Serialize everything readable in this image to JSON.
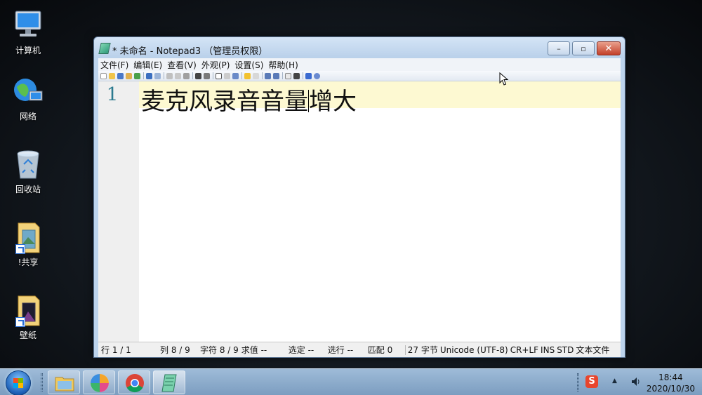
{
  "desktop": {
    "icons": [
      {
        "label": "计算机",
        "icon": "computer-icon"
      },
      {
        "label": "网络",
        "icon": "network-icon"
      },
      {
        "label": "回收站",
        "icon": "recycle-bin-icon"
      },
      {
        "label": "!共享",
        "icon": "folder-shortcut-icon"
      },
      {
        "label": "壁纸",
        "icon": "folder-shortcut-icon"
      }
    ]
  },
  "window": {
    "title": "* 未命名 - Notepad3 （管理员权限）",
    "controls": {
      "minimize": "–",
      "maximize": "▫",
      "close": "✕"
    },
    "menu": [
      "文件(F)",
      "编辑(E)",
      "查看(V)",
      "外观(P)",
      "设置(S)",
      "帮助(H)"
    ],
    "editor": {
      "line_number": "1",
      "text_before_caret": "麦克风录音音量",
      "text_after_caret": "增大"
    },
    "status": {
      "line": "行 1 / 1",
      "column": "列 8 / 9",
      "chars": "字符 8 / 9",
      "sum": "求值 --",
      "selection": "选定 --",
      "sel_lines": "选行 --",
      "match": "匹配 0",
      "size": "27 字节",
      "encoding": "Unicode (UTF-8)",
      "eol": "CR+LF",
      "ins": "INS",
      "std": "STD",
      "type": "文本文件"
    }
  },
  "taskbar": {
    "apps": [
      "file-explorer-icon",
      "pinwheel-app-icon",
      "chrome-icon",
      "notepad3-icon"
    ],
    "tray": {
      "ime": "S",
      "time": "18:44",
      "date": "2020/10/30"
    }
  },
  "colors": {
    "current_line": "#fdf9d2",
    "line_number": "#2b7a8f",
    "close_button": "#c3402a"
  }
}
